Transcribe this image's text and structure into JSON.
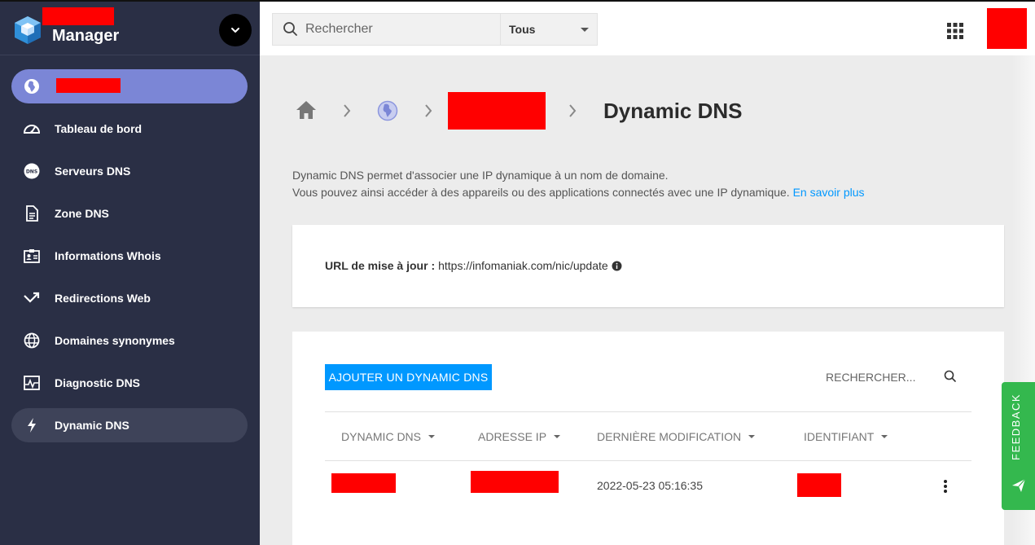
{
  "app": {
    "brand_name": "Manager"
  },
  "topbar": {
    "search_placeholder": "Rechercher",
    "scope_value": "Tous"
  },
  "sidebar": {
    "items": [
      {
        "label": "Tableau de bord",
        "icon": "dashboard-gauge-icon"
      },
      {
        "label": "Serveurs DNS",
        "icon": "dns-badge-icon"
      },
      {
        "label": "Zone DNS",
        "icon": "document-icon"
      },
      {
        "label": "Informations Whois",
        "icon": "id-card-icon"
      },
      {
        "label": "Redirections Web",
        "icon": "redirect-arrow-icon"
      },
      {
        "label": "Domaines synonymes",
        "icon": "globe-icon"
      },
      {
        "label": "Diagnostic DNS",
        "icon": "pulse-icon"
      },
      {
        "label": "Dynamic DNS",
        "icon": "lightning-icon",
        "active": true
      }
    ]
  },
  "page": {
    "title": "Dynamic DNS",
    "description_line1": "Dynamic DNS permet d'associer une IP dynamique à un nom de domaine.",
    "description_line2": "Vous pouvez ainsi accéder à des appareils ou des applications connectés avec une IP dynamique.",
    "learn_more": "En savoir plus"
  },
  "url_card": {
    "label": "URL de mise à jour :",
    "value": "https://infomaniak.com/nic/update"
  },
  "table": {
    "add_button": "AJOUTER UN DYNAMIC DNS",
    "search_placeholder": "RECHERCHER...",
    "columns": [
      "DYNAMIC DNS",
      "ADRESSE IP",
      "DERNIÈRE MODIFICATION",
      "IDENTIFIANT"
    ],
    "rows": [
      {
        "dynamic_dns": "",
        "ip": "",
        "last_modified": "2022-05-23 05:16:35",
        "identifier": ""
      }
    ]
  },
  "feedback": {
    "label": "FEEDBACK"
  },
  "colors": {
    "sidebar_bg": "#2a2f45",
    "domain_pill": "#7b86d6",
    "accent_blue": "#0098ff",
    "feedback_green": "#34b84e",
    "redaction": "#ff0000"
  }
}
